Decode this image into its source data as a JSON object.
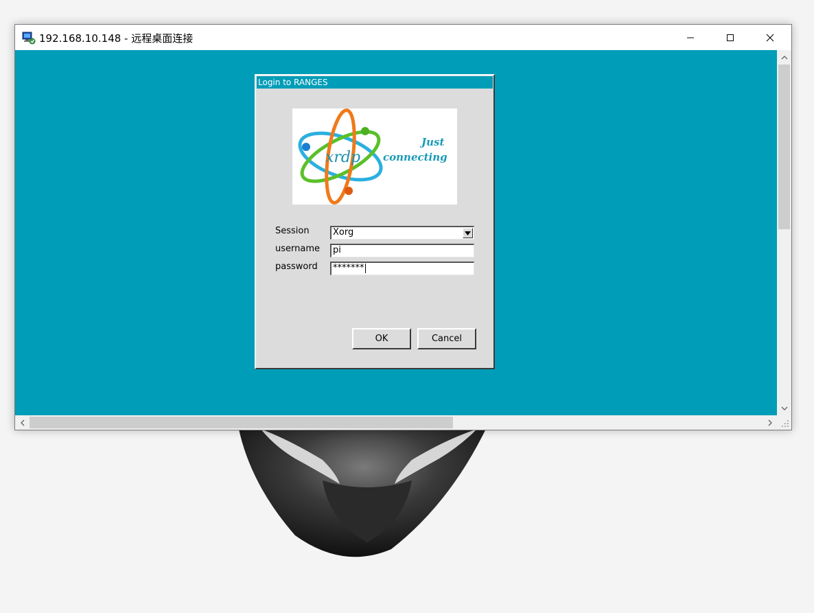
{
  "window": {
    "title": "192.168.10.148 - 远程桌面连接"
  },
  "dialog": {
    "title": "Login to RANGES",
    "logo": {
      "brand": "xrdp",
      "tagline_1": "Just",
      "tagline_2": "connecting"
    },
    "form": {
      "session_label": "Session",
      "session_value": "Xorg",
      "username_label": "username",
      "username_value": "pi",
      "password_label": "password",
      "password_value": "*******"
    },
    "buttons": {
      "ok": "OK",
      "cancel": "Cancel"
    }
  },
  "colors": {
    "desktop_teal": "#009db8",
    "dialog_gray": "#dcdcdc"
  },
  "icons": {
    "app": "remote-desktop-icon",
    "minimize": "minimize-icon",
    "maximize": "maximize-icon",
    "close": "close-icon",
    "dropdown": "dropdown-arrow-icon"
  }
}
